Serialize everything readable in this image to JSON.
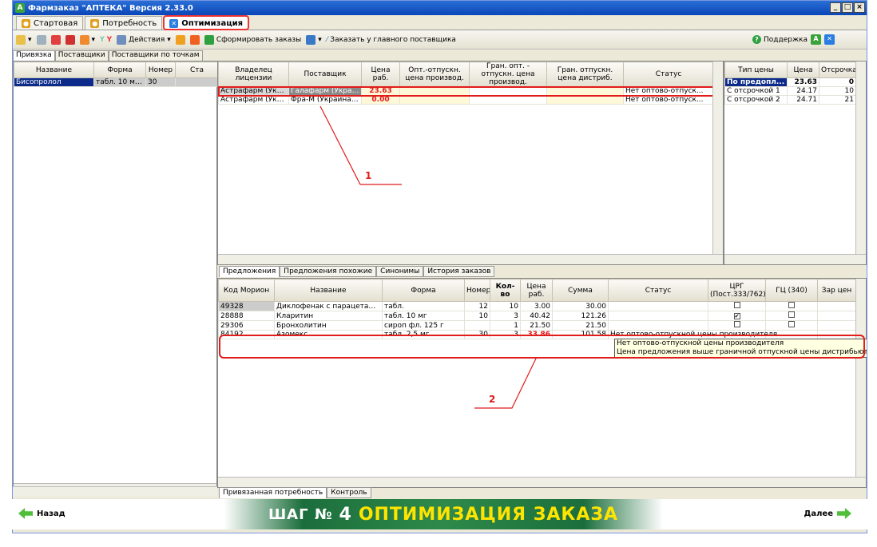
{
  "window": {
    "title": "Фармзаказ \"АПТЕКА\" Версия 2.33.0"
  },
  "tabs": [
    {
      "label": "Стартовая"
    },
    {
      "label": "Потребность"
    },
    {
      "label": "Оптимизация"
    }
  ],
  "toolbar": {
    "actions": "Действия",
    "form_orders": "Сформировать заказы",
    "order_main": "Заказать у главного поставщика",
    "support": "Поддержка"
  },
  "subtabs": [
    "Привязка",
    "Поставщики",
    "Поставщики по точкам"
  ],
  "need": {
    "headers": [
      "Название",
      "Форма",
      "Номер",
      "Ста"
    ],
    "rows": [
      [
        "Бисопролол",
        "табл. 10 мг 6...",
        "30",
        ""
      ]
    ]
  },
  "suppliers": {
    "headers": [
      "Владелец лицензии",
      "Поставщик",
      "Цена раб.",
      "Опт.-отпускн. цена производ.",
      "Гран. опт. - отпускн. цена производ.",
      "Гран. отпускн. цена дистриб.",
      "Статус"
    ],
    "rows": [
      [
        "Астрафарм (Украи...",
        "Галафарм (Украин...",
        "23.63",
        "",
        "",
        "",
        "Нет оптово-отпуск..."
      ],
      [
        "Астрафарм (Украи...",
        "Фра-М (Украина, ...",
        "0.00",
        "",
        "",
        "",
        "Нет оптово-отпуск..."
      ]
    ]
  },
  "prices": {
    "headers": [
      "Тип цены",
      "Цена",
      "Отсрочка"
    ],
    "rows": [
      [
        "По предопл...",
        "23.63",
        "0"
      ],
      [
        "С отсрочкой 1",
        "24.17",
        "10"
      ],
      [
        "С отсрочкой 2",
        "24.71",
        "21"
      ]
    ]
  },
  "offers_tabs": [
    "Предложения",
    "Предложения похожие",
    "Синонимы",
    "История заказов"
  ],
  "offers": {
    "headers": [
      "Код Морион",
      "Название",
      "Форма",
      "Номер",
      "Кол-во",
      "Цена раб.",
      "Сумма",
      "Статус",
      "ЦРГ (Пост.333/762)",
      "ГЦ (340)",
      "Зар цен"
    ],
    "rows": [
      {
        "code": "49328",
        "name": "Диклофенак с парацетамолом",
        "form": "табл.",
        "num": "12",
        "qty": "10",
        "price": "3.00",
        "sum": "30.00",
        "status": "",
        "crg": false,
        "gc": false
      },
      {
        "code": "28888",
        "name": "Кларитин",
        "form": "табл. 10 мг",
        "num": "10",
        "qty": "3",
        "price": "40.42",
        "sum": "121.26",
        "status": "",
        "crg": true,
        "gc": false
      },
      {
        "code": "29306",
        "name": "Бронхолитин",
        "form": "сироп фл. 125 г",
        "num": "",
        "qty": "1",
        "price": "21.50",
        "sum": "21.50",
        "status": "",
        "crg": false,
        "gc": false
      },
      {
        "code": "84192",
        "name": "Азомекс",
        "form": "табл. 2,5 мг",
        "num": "30",
        "qty": "3",
        "price": "33.86",
        "sum": "101.58",
        "status": "Нет оптово-отпускной цены производителя",
        "crg": false,
        "gc": false
      }
    ]
  },
  "tooltip": {
    "line1": "Нет оптово-отпускной цены производителя",
    "line2": "Цена предложения выше граничной отпускной цены дистрибьютора"
  },
  "bottom_tabs": [
    "Привязанная потребность",
    "Контроль"
  ],
  "banner": {
    "back": "Назад",
    "step_prefix": "ШАГ №",
    "step_num": "4",
    "step_title": "ОПТИМИЗАЦИЯ ЗАКАЗА",
    "next": "Далее"
  },
  "annotations": [
    "1",
    "2"
  ],
  "colors": {
    "accent_red": "#e21b1b",
    "selection": "#0b2a8a",
    "banner_green": "#1b6e3c",
    "step_yellow": "#ffe400"
  }
}
